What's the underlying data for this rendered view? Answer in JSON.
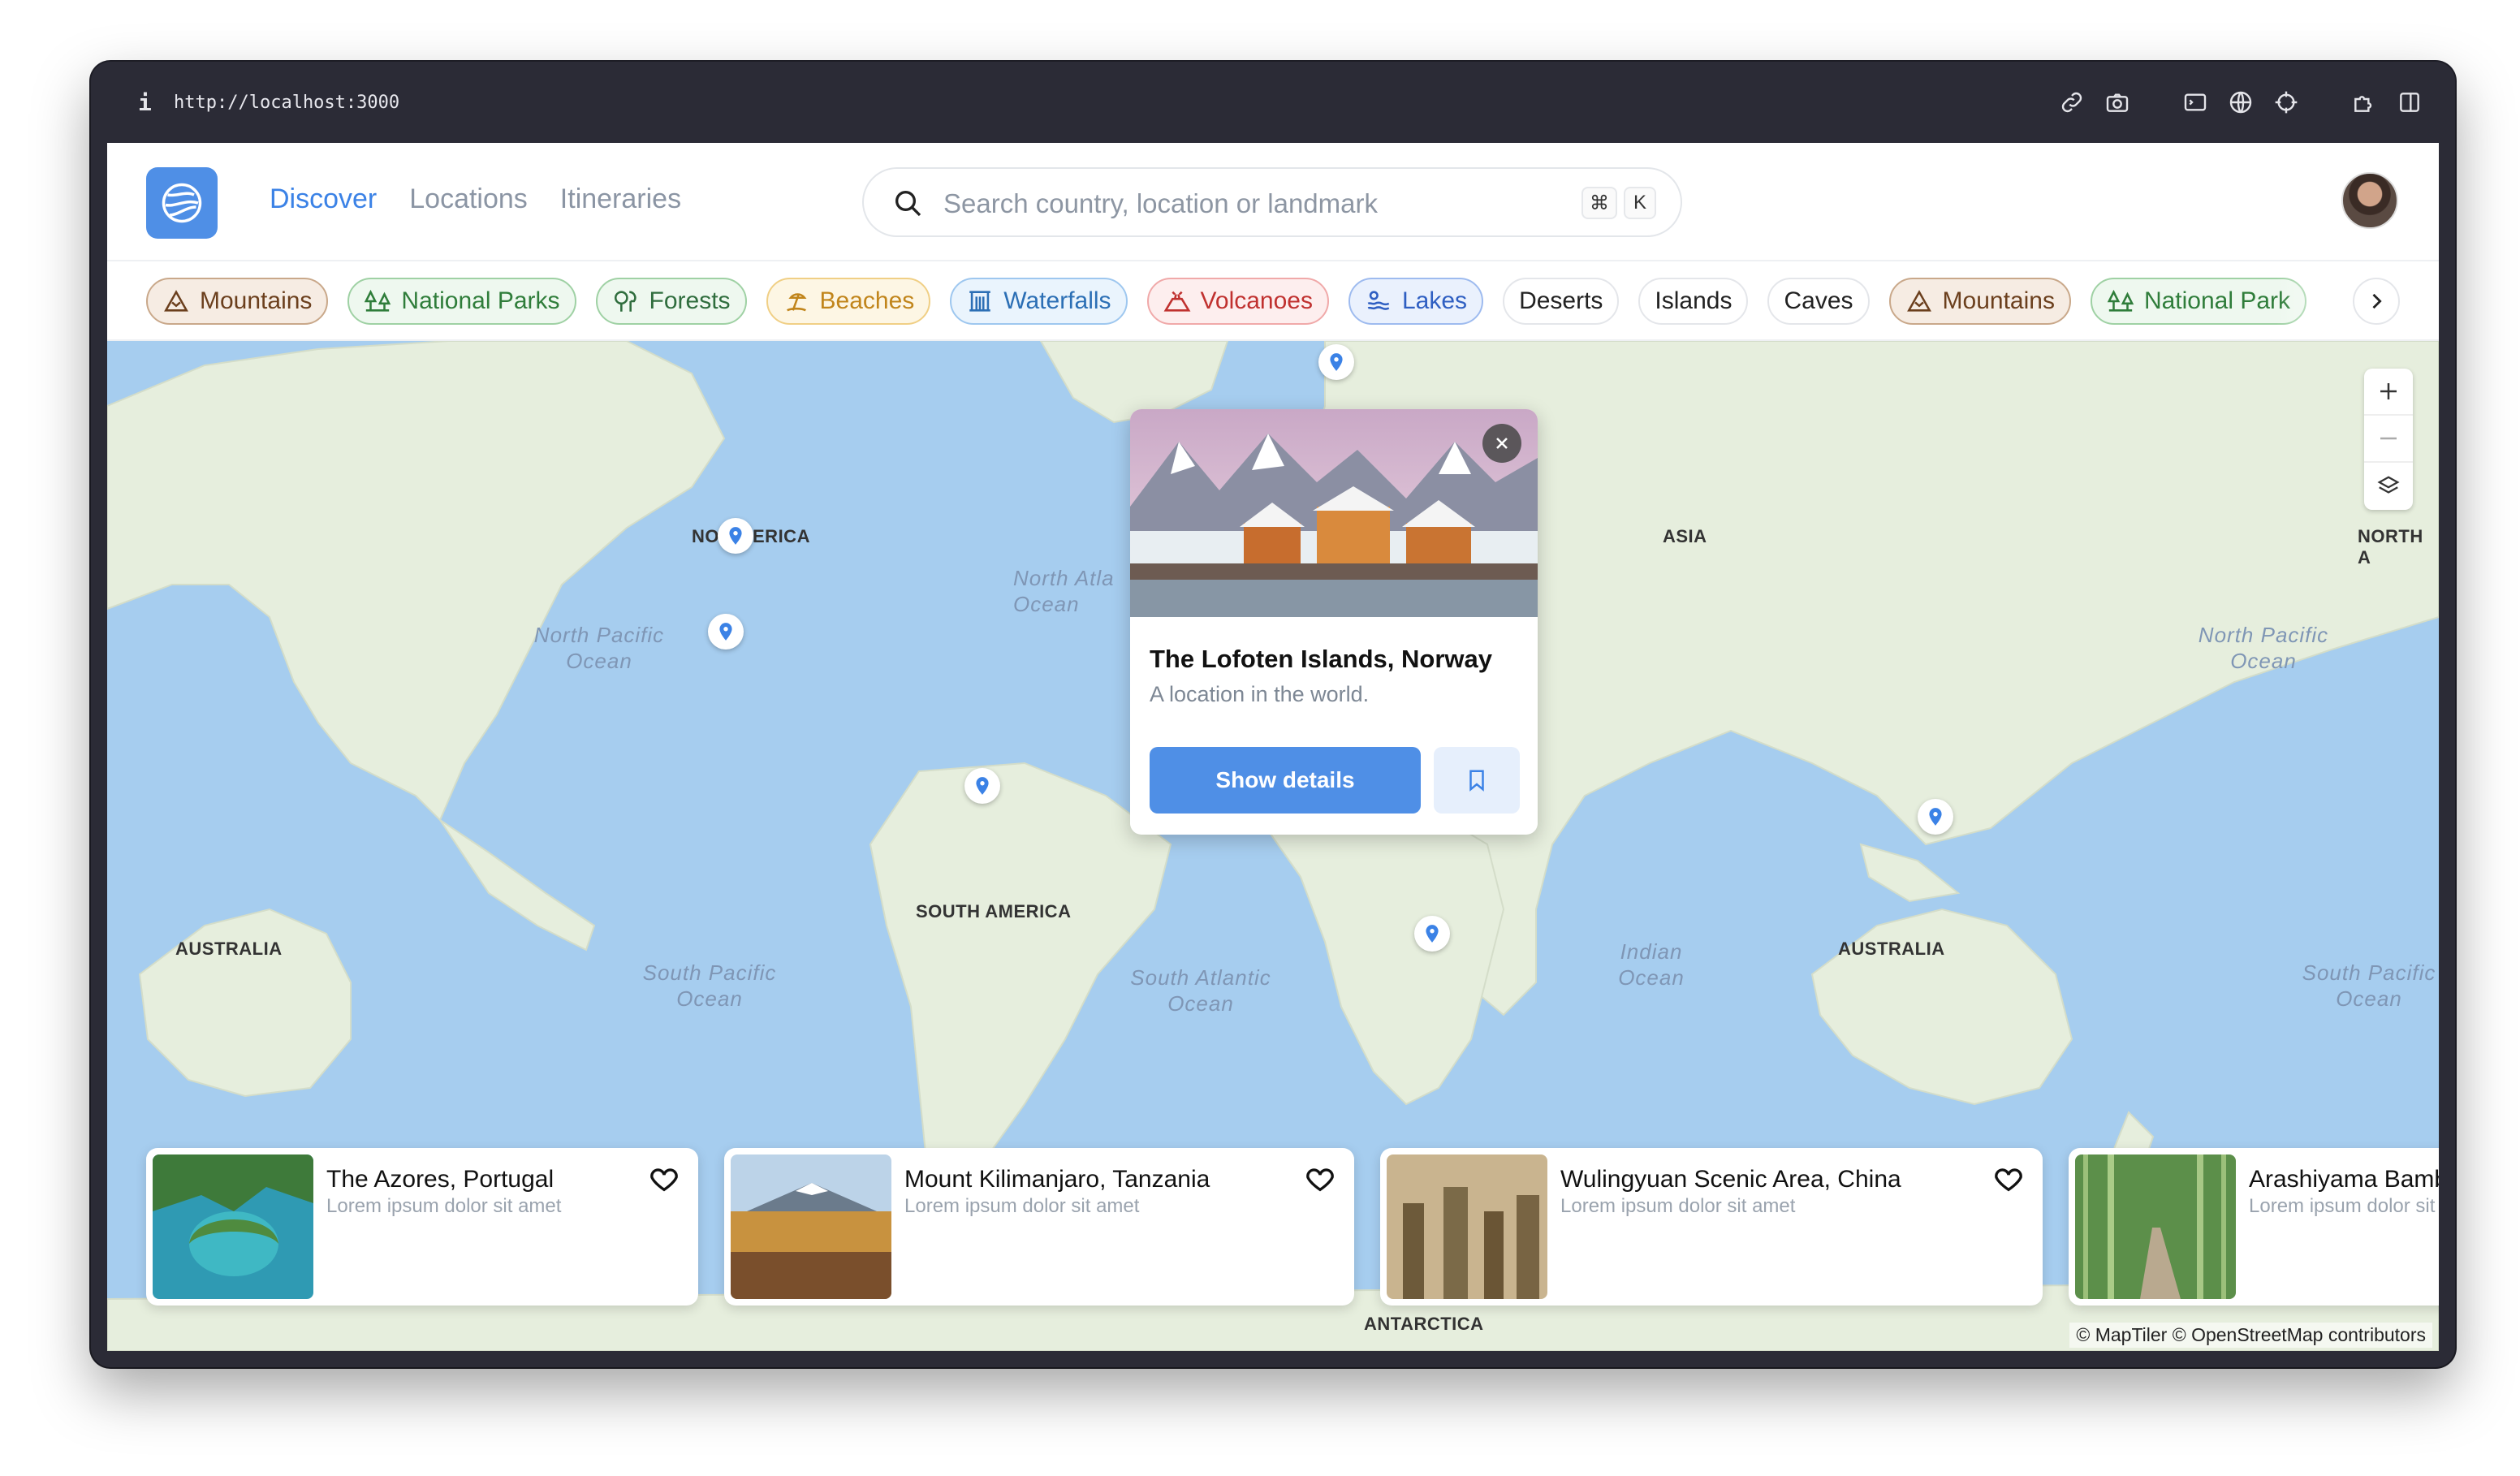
{
  "browser": {
    "url": "http://localhost:3000",
    "info_glyph": "i"
  },
  "nav": {
    "discover": "Discover",
    "locations": "Locations",
    "itineraries": "Itineraries"
  },
  "search": {
    "placeholder": "Search country, location or landmark",
    "kbd_cmd": "⌘",
    "kbd_key": "K"
  },
  "chips": [
    {
      "label": "Mountains",
      "icon": "mountain-icon"
    },
    {
      "label": "National Parks",
      "icon": "park-icon"
    },
    {
      "label": "Forests",
      "icon": "trees-icon"
    },
    {
      "label": "Beaches",
      "icon": "beach-icon"
    },
    {
      "label": "Waterfalls",
      "icon": "waterfall-icon"
    },
    {
      "label": "Volcanoes",
      "icon": "volcano-icon"
    },
    {
      "label": "Lakes",
      "icon": "lake-icon"
    },
    {
      "label": "Deserts"
    },
    {
      "label": "Islands"
    },
    {
      "label": "Caves"
    },
    {
      "label": "Mountains",
      "icon": "mountain-icon"
    },
    {
      "label": "National Park",
      "icon": "park-icon"
    }
  ],
  "map": {
    "continents": {
      "north_america": "NO   AMERICA",
      "asia": "ASIA",
      "south_america": "SOUTH AMERICA",
      "australia_left": "AUSTRALIA",
      "australia_right": "AUSTRALIA",
      "north_a_edge": "NORTH A",
      "antarctica": "ANTARCTICA"
    },
    "oceans": {
      "north_pacific_left": "North Pacific\nOcean",
      "north_atlantic": "North Atla\nOcean",
      "north_pacific_right": "North Pacific\nOcean",
      "south_pacific_left": "South Pacific\nOcean",
      "south_atlantic": "South Atlantic\nOcean",
      "indian": "Indian\nOcean",
      "south_pacific_right": "South Pacific\nOcean"
    },
    "attribution": "© MapTiler © OpenStreetMap contributors",
    "colors": {
      "water": "#a6cdef",
      "land": "#e6eedd",
      "pin": "#3b82e6"
    }
  },
  "popup": {
    "title": "The Lofoten Islands, Norway",
    "subtitle": "A location in the world.",
    "button": "Show details"
  },
  "cards": [
    {
      "title": "The Azores, Portugal",
      "subtitle": "Lorem ipsum dolor sit amet"
    },
    {
      "title": "Mount Kilimanjaro, Tanzania",
      "subtitle": "Lorem ipsum dolor sit amet"
    },
    {
      "title": "Wulingyuan Scenic Area, China",
      "subtitle": "Lorem ipsum dolor sit amet"
    },
    {
      "title": "Arashiyama Bamboo Grove, Japan",
      "subtitle": "Lorem ipsum dolor sit amet"
    }
  ]
}
